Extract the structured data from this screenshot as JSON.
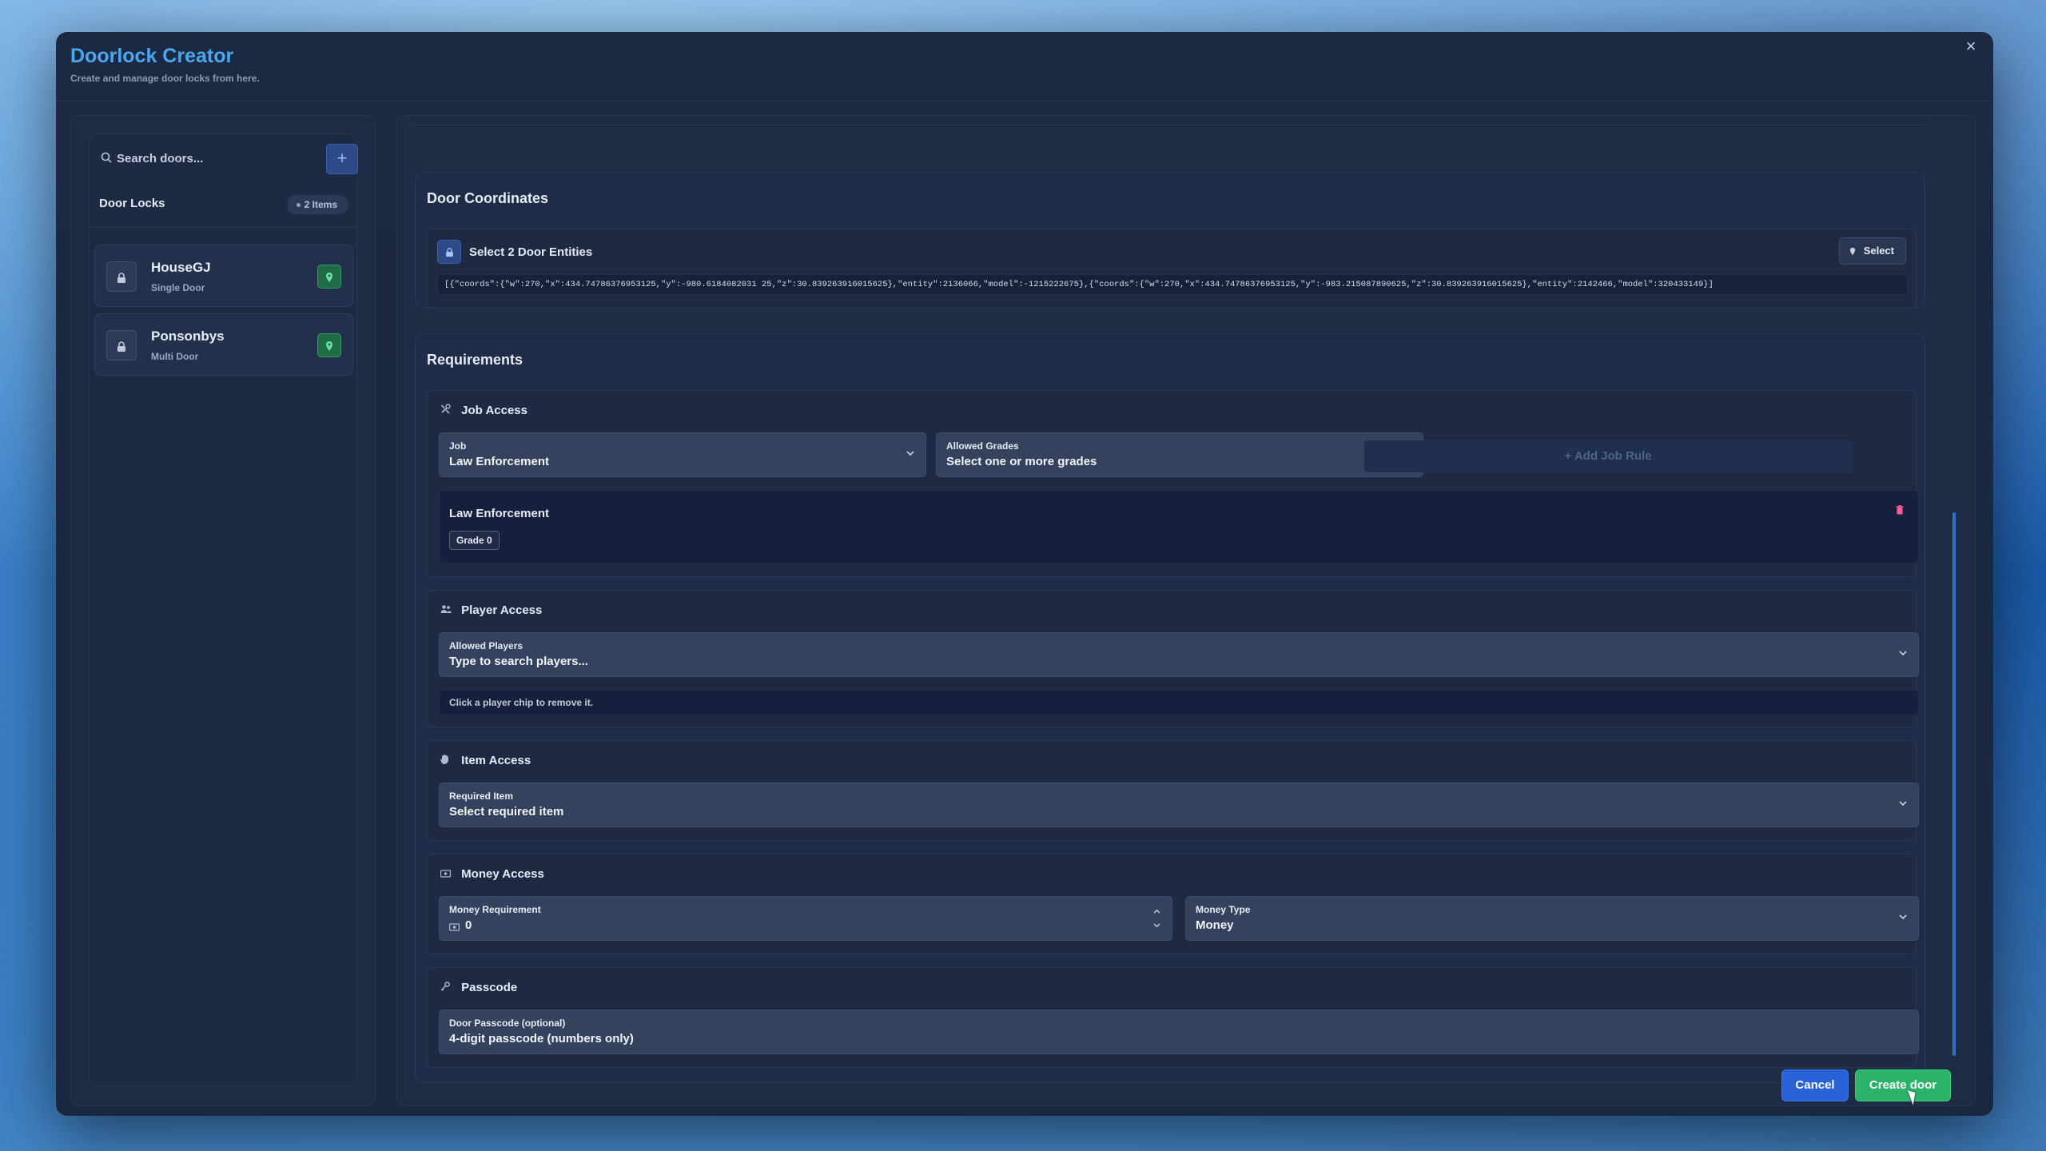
{
  "app": {
    "title": "Doorlock Creator",
    "subtitle": "Create and manage door locks from here.",
    "close_glyph": "×"
  },
  "sidebar": {
    "search_placeholder": "Search doors...",
    "add_glyph": "+",
    "list_title": "Door Locks",
    "count_label": "2 Items",
    "doors": [
      {
        "name": "HouseGJ",
        "type": "Single Door"
      },
      {
        "name": "Ponsonbys",
        "type": "Multi Door"
      }
    ]
  },
  "coordinates": {
    "title": "Door Coordinates",
    "entities_label": "Select 2 Door Entities",
    "select_label": "Select",
    "value": "[{\"coords\":{\"w\":270,\"x\":434.74786376953125,\"y\":-980.6184082031 25,\"z\":30.839263916015625},\"entity\":2136066,\"model\":-1215222675},{\"coords\":{\"w\":270,\"x\":434.74786376953125,\"y\":-983.215087890625,\"z\":30.839263916015625},\"entity\":2142466,\"model\":320433149}]"
  },
  "requirements": {
    "title": "Requirements",
    "job_access": {
      "title": "Job Access",
      "job_label": "Job",
      "job_value": "Law Enforcement",
      "grades_label": "Allowed Grades",
      "grades_value": "Select one or more grades",
      "add_rule_label": "+ Add Job Rule",
      "rule": {
        "name": "Law Enforcement",
        "chip": "Grade 0"
      }
    },
    "player_access": {
      "title": "Player Access",
      "players_label": "Allowed Players",
      "players_value": "Type to search players...",
      "hint": "Click a player chip to remove it."
    },
    "item_access": {
      "title": "Item Access",
      "item_label": "Required Item",
      "item_value": "Select required item"
    },
    "money_access": {
      "title": "Money Access",
      "amount_label": "Money Requirement",
      "amount_value": "0",
      "type_label": "Money Type",
      "type_value": "Money"
    },
    "passcode": {
      "title": "Passcode",
      "passcode_label": "Door Passcode (optional)",
      "passcode_value": "4-digit passcode (numbers only)"
    }
  },
  "footer": {
    "cancel_label": "Cancel",
    "create_label": "Create door"
  },
  "colors": {
    "accent": "#4aa8f0",
    "primary_button": "#2961d6",
    "success_button": "#2bb36a",
    "danger": "#ff5e8f",
    "window_bg": "#1c2943"
  }
}
